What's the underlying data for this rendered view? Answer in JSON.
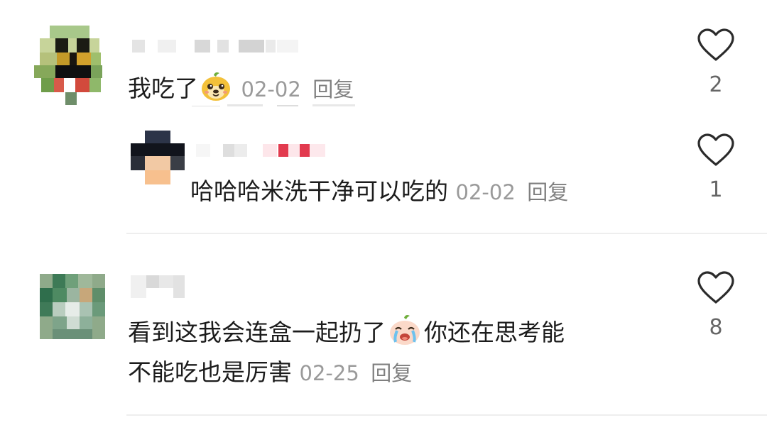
{
  "comments": [
    {
      "text": "我吃了",
      "emoji": "dog-face-emoji",
      "date": "02-02",
      "reply_label": "回复",
      "likes": "2",
      "replies": [
        {
          "text": "哈哈哈米洗干净可以吃的",
          "date": "02-02",
          "reply_label": "回复",
          "likes": "1"
        }
      ]
    },
    {
      "text_line1": "看到这我会连盒一起扔了",
      "emoji": "crying-face-emoji",
      "text_line1_tail": "你还在思考能",
      "text_line2": "不能吃也是厉害",
      "date": "02-25",
      "reply_label": "回复",
      "likes": "8"
    }
  ],
  "icons": {
    "like": "heart-outline-icon"
  },
  "colors": {
    "text": "#1c1c1c",
    "meta": "#9a9a9a",
    "divider": "#eeeeee",
    "heart_stroke": "#2b2b2b"
  }
}
